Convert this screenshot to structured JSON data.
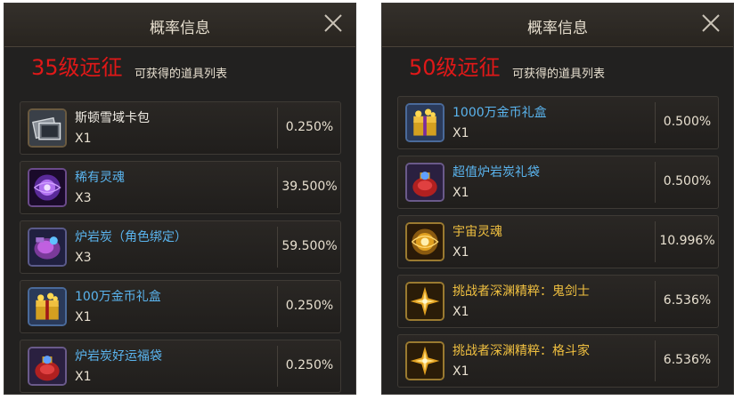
{
  "panels": [
    {
      "title": "概率信息",
      "level": "35级远征",
      "subtitle": "可获得的道具列表",
      "items": [
        {
          "name": "斯顿雪域卡包",
          "qty": "X1",
          "prob": "0.250%",
          "icon": "card-pack-icon",
          "name_color": "#f0ece4"
        },
        {
          "name": "稀有灵魂",
          "qty": "X3",
          "prob": "39.500%",
          "icon": "purple-soul-icon",
          "name_color": "#5ab4ee"
        },
        {
          "name": "炉岩炭（角色绑定）",
          "qty": "X3",
          "prob": "59.500%",
          "icon": "lava-coal-icon",
          "name_color": "#5ab4ee"
        },
        {
          "name": "100万金币礼盒",
          "qty": "X1",
          "prob": "0.250%",
          "icon": "gold-box-icon",
          "name_color": "#5ab4ee"
        },
        {
          "name": "炉岩炭好运福袋",
          "qty": "X1",
          "prob": "0.250%",
          "icon": "lucky-bag-icon",
          "name_color": "#5ab4ee"
        }
      ]
    },
    {
      "title": "概率信息",
      "level": "50级远征",
      "subtitle": "可获得的道具列表",
      "items": [
        {
          "name": "1000万金币礼盒",
          "qty": "X1",
          "prob": "0.500%",
          "icon": "gold-box-icon",
          "name_color": "#5ab4ee"
        },
        {
          "name": "超值炉岩炭礼袋",
          "qty": "X1",
          "prob": "0.500%",
          "icon": "lucky-bag-icon",
          "name_color": "#5ab4ee"
        },
        {
          "name": "宇宙灵魂",
          "qty": "X1",
          "prob": "10.996%",
          "icon": "gold-soul-icon",
          "name_color": "#f0c040"
        },
        {
          "name": "挑战者深渊精粹：鬼剑士",
          "qty": "X1",
          "prob": "6.536%",
          "icon": "abyss-essence-icon",
          "name_color": "#f0c040"
        },
        {
          "name": "挑战者深渊精粹：格斗家",
          "qty": "X1",
          "prob": "6.536%",
          "icon": "abyss-essence-icon",
          "name_color": "#f0c040"
        }
      ]
    }
  ],
  "colors": {
    "panel_bg": "#222120",
    "level_red": "#e01818",
    "blue_name": "#5ab4ee",
    "gold_name": "#f0c040"
  }
}
